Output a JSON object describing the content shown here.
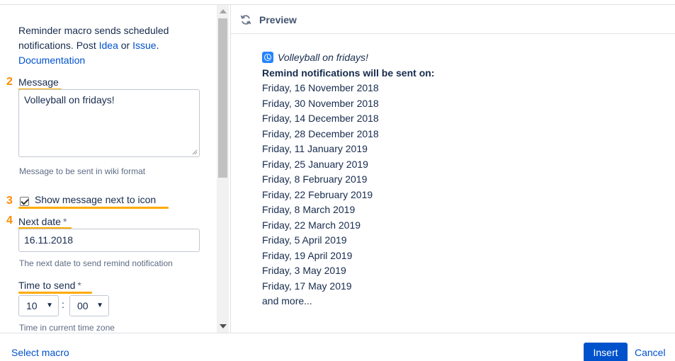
{
  "left": {
    "intro_text": "Reminder macro sends scheduled notifications. Post ",
    "idea_link": "Idea",
    "or_text": " or ",
    "issue_link": "Issue",
    "period": ".",
    "documentation_link": "Documentation",
    "message": {
      "step": "2",
      "label": "Message",
      "value": "Volleyball on fridays!",
      "help": "Message to be sent in wiki format"
    },
    "show_icon": {
      "step": "3",
      "label": "Show message next to icon",
      "checked": true
    },
    "next_date": {
      "step": "4",
      "label": "Next date",
      "required": "*",
      "value": "16.11.2018",
      "help": "The next date to send remind notification"
    },
    "time_to_send": {
      "label": "Time to send",
      "required": "*",
      "hour": "10",
      "separator": ":",
      "minute": "00",
      "help": "Time in current time zone"
    }
  },
  "preview": {
    "title": "Preview",
    "reminder_message": "Volleyball on fridays!",
    "heading": "Remind notifications will be sent on:",
    "dates": [
      "Friday, 16 November 2018",
      "Friday, 30 November 2018",
      "Friday, 14 December 2018",
      "Friday, 28 December 2018",
      "Friday, 11 January 2019",
      "Friday, 25 January 2019",
      "Friday, 8 February 2019",
      "Friday, 22 February 2019",
      "Friday, 8 March 2019",
      "Friday, 22 March 2019",
      "Friday, 5 April 2019",
      "Friday, 19 April 2019",
      "Friday, 3 May 2019",
      "Friday, 17 May 2019"
    ],
    "more": "and more..."
  },
  "footer": {
    "select_macro": "Select macro",
    "insert": "Insert",
    "cancel": "Cancel"
  },
  "colors": {
    "accent": "#0052cc",
    "step_number": "#ff8b00",
    "step_underline": "#ffab00"
  }
}
